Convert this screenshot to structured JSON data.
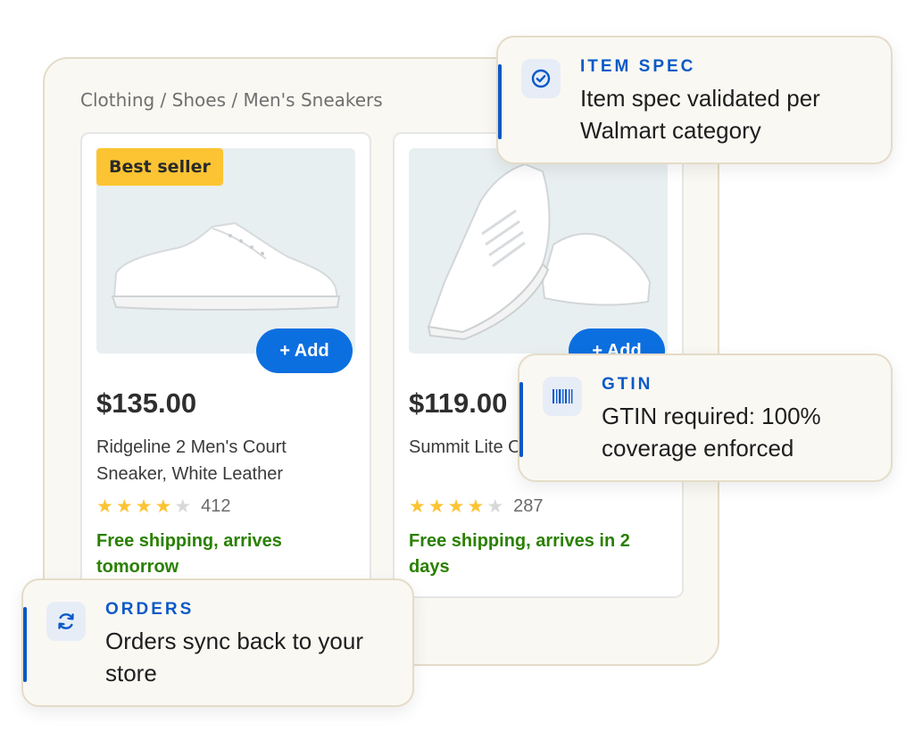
{
  "breadcrumb": "Clothing / Shoes / Men's Sneakers",
  "products": [
    {
      "badge": "Best seller",
      "add_label": "+ Add",
      "price": "$135.00",
      "title": "Ridgeline 2 Men's Court Sneaker, White Leather",
      "rating": 4,
      "reviews": "412",
      "shipping": "Free shipping, arrives tomorrow"
    },
    {
      "add_label": "+ Add",
      "price": "$119.00",
      "title": "Summit Lite Off-White",
      "rating": 4,
      "reviews": "287",
      "shipping": "Free shipping, arrives in 2 days"
    }
  ],
  "callouts": {
    "item_spec": {
      "tag": "ITEM SPEC",
      "text": "Item spec validated per Walmart category",
      "icon": "check-circle-icon"
    },
    "gtin": {
      "tag": "GTIN",
      "text": "GTIN required: 100% coverage enforced",
      "icon": "barcode-icon"
    },
    "orders": {
      "tag": "ORDERS",
      "text": "Orders sync back to your store",
      "icon": "sync-icon"
    }
  },
  "colors": {
    "accent": "#0a59c8",
    "button": "#0c6fe0",
    "badge": "#fcc433",
    "shipping": "#2a8000",
    "star": "#fcc433"
  }
}
